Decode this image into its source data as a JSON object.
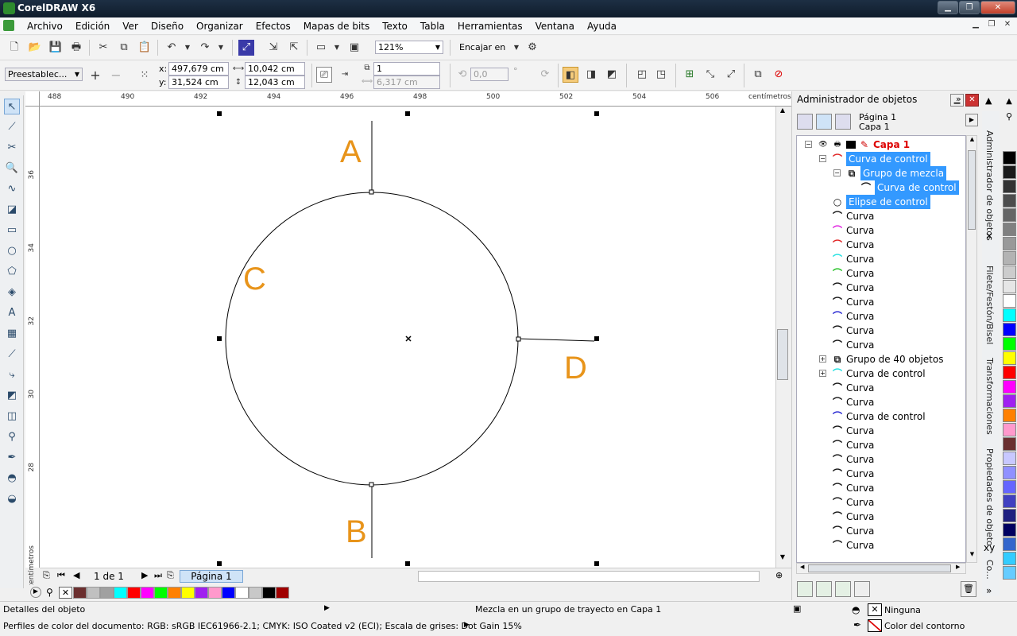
{
  "window": {
    "title": "CorelDRAW X6"
  },
  "menu": {
    "items": [
      "Archivo",
      "Edición",
      "Ver",
      "Diseño",
      "Organizar",
      "Efectos",
      "Mapas de bits",
      "Texto",
      "Tabla",
      "Herramientas",
      "Ventana",
      "Ayuda"
    ]
  },
  "toolbar1": {
    "zoom": "121%",
    "snap_label": "Encajar en"
  },
  "toolbar2": {
    "preset": "Preestablec...",
    "x": "497,679 cm",
    "y": "31,524 cm",
    "width": "10,042 cm",
    "height": "12,043 cm",
    "steps": "1",
    "spacing": "6,317 cm",
    "rotation": "0,0",
    "x_label": "x:",
    "y_label": "y:"
  },
  "ruler": {
    "h_ticks": [
      "488",
      "490",
      "492",
      "494",
      "496",
      "498",
      "500",
      "502",
      "504",
      "506"
    ],
    "h_unit": "centímetros",
    "v_ticks": [
      "36",
      "34",
      "32",
      "30",
      "28"
    ],
    "v_unit": "centímetros"
  },
  "canvas": {
    "labels": [
      "A",
      "B",
      "C",
      "D"
    ]
  },
  "pagebar": {
    "counter": "1 de 1",
    "tab": "Página 1"
  },
  "docker": {
    "title": "Administrador de objetos",
    "page": "Página 1",
    "layer": "Capa 1",
    "tree": [
      {
        "label": "Capa 1",
        "kind": "layer",
        "indent": 0,
        "expander": "−",
        "icon": "pen-icon",
        "color": "#d00000"
      },
      {
        "label": "Curva de control",
        "kind": "selected",
        "indent": 1,
        "expander": "−",
        "icon": "curve-icon",
        "color": "#e02020"
      },
      {
        "label": "Grupo de mezcla",
        "kind": "selected",
        "indent": 2,
        "expander": "−",
        "icon": "group-icon",
        "color": "#222222"
      },
      {
        "label": "Curva de control",
        "kind": "selected",
        "indent": 3,
        "expander": "",
        "icon": "curve-icon",
        "color": "#111111"
      },
      {
        "label": "Elipse de control",
        "kind": "selected",
        "indent": 1,
        "expander": "",
        "icon": "ellipse-icon",
        "color": "#111111"
      },
      {
        "label": "Curva",
        "kind": "normal",
        "indent": 1,
        "expander": "",
        "icon": "curve-icon",
        "color": "#111111"
      },
      {
        "label": "Curva",
        "kind": "normal",
        "indent": 1,
        "expander": "",
        "icon": "curve-icon",
        "color": "#e020e0"
      },
      {
        "label": "Curva",
        "kind": "normal",
        "indent": 1,
        "expander": "",
        "icon": "curve-icon",
        "color": "#e02020"
      },
      {
        "label": "Curva",
        "kind": "normal",
        "indent": 1,
        "expander": "",
        "icon": "curve-icon",
        "color": "#20e0e0"
      },
      {
        "label": "Curva",
        "kind": "normal",
        "indent": 1,
        "expander": "",
        "icon": "curve-icon",
        "color": "#20c020"
      },
      {
        "label": "Curva",
        "kind": "normal",
        "indent": 1,
        "expander": "",
        "icon": "curve-icon",
        "color": "#111111"
      },
      {
        "label": "Curva",
        "kind": "normal",
        "indent": 1,
        "expander": "",
        "icon": "curve-icon",
        "color": "#111111"
      },
      {
        "label": "Curva",
        "kind": "normal",
        "indent": 1,
        "expander": "",
        "icon": "curve-icon",
        "color": "#2020d0"
      },
      {
        "label": "Curva",
        "kind": "normal",
        "indent": 1,
        "expander": "",
        "icon": "curve-icon",
        "color": "#111111"
      },
      {
        "label": "Curva",
        "kind": "normal",
        "indent": 1,
        "expander": "",
        "icon": "curve-icon",
        "color": "#111111"
      },
      {
        "label": "Grupo de 40 objetos",
        "kind": "normal",
        "indent": 1,
        "expander": "+",
        "icon": "group-icon",
        "color": "#222222"
      },
      {
        "label": "Curva de control",
        "kind": "normal",
        "indent": 1,
        "expander": "+",
        "icon": "curve-icon",
        "color": "#20e0e0"
      },
      {
        "label": "Curva",
        "kind": "normal",
        "indent": 1,
        "expander": "",
        "icon": "curve-icon",
        "color": "#111111"
      },
      {
        "label": "Curva",
        "kind": "normal",
        "indent": 1,
        "expander": "",
        "icon": "curve-icon",
        "color": "#111111"
      },
      {
        "label": "Curva de control",
        "kind": "normal",
        "indent": 1,
        "expander": "",
        "icon": "curve-icon",
        "color": "#2020d0"
      },
      {
        "label": "Curva",
        "kind": "normal",
        "indent": 1,
        "expander": "",
        "icon": "curve-icon",
        "color": "#111111"
      },
      {
        "label": "Curva",
        "kind": "normal",
        "indent": 1,
        "expander": "",
        "icon": "curve-icon",
        "color": "#111111"
      },
      {
        "label": "Curva",
        "kind": "normal",
        "indent": 1,
        "expander": "",
        "icon": "curve-icon",
        "color": "#111111"
      },
      {
        "label": "Curva",
        "kind": "normal",
        "indent": 1,
        "expander": "",
        "icon": "curve-icon",
        "color": "#111111"
      },
      {
        "label": "Curva",
        "kind": "normal",
        "indent": 1,
        "expander": "",
        "icon": "curve-icon",
        "color": "#111111"
      },
      {
        "label": "Curva",
        "kind": "normal",
        "indent": 1,
        "expander": "",
        "icon": "curve-icon",
        "color": "#111111"
      },
      {
        "label": "Curva",
        "kind": "normal",
        "indent": 1,
        "expander": "",
        "icon": "curve-icon",
        "color": "#111111"
      },
      {
        "label": "Curva",
        "kind": "normal",
        "indent": 1,
        "expander": "",
        "icon": "curve-icon",
        "color": "#111111"
      },
      {
        "label": "Curva",
        "kind": "normal",
        "indent": 1,
        "expander": "",
        "icon": "curve-icon",
        "color": "#111111"
      }
    ]
  },
  "side_tabs": [
    "Administrador de objetos",
    "Filete/Festón/Bisel",
    "Transformaciones",
    "Propiedades de objeto",
    "Co..."
  ],
  "side_tab_xy": "xy",
  "palette_bottom": [
    "#6b2f2f",
    "#c0c0c0",
    "#a0a0a0",
    "#00ffff",
    "#ff0000",
    "#ff00ff",
    "#00ff00",
    "#ff8000",
    "#ffff00",
    "#a020f0",
    "#ff99cc",
    "#0000ff",
    "#ffffff",
    "#c8c8c8",
    "#000000",
    "#a00000"
  ],
  "palette_right": [
    "#000000",
    "#1a1a1a",
    "#333333",
    "#4d4d4d",
    "#666666",
    "#808080",
    "#999999",
    "#b3b3b3",
    "#cccccc",
    "#e6e6e6",
    "#ffffff",
    "#00ffff",
    "#0000ff",
    "#00ff00",
    "#ffff00",
    "#ff0000",
    "#ff00ff",
    "#a020f0",
    "#ff8000",
    "#ff99cc",
    "#6b2f2f",
    "#c8c8ff",
    "#9090ff",
    "#6666ff",
    "#4040c0",
    "#202080",
    "#000060",
    "#3366cc",
    "#33ccff",
    "#66ccff"
  ],
  "status": {
    "object_details": "Detalles del objeto",
    "message": "Mezcla en un grupo de trayecto en Capa 1",
    "color_profiles": "Perfiles de color del documento: RGB: sRGB IEC61966-2.1; CMYK: ISO Coated v2 (ECI); Escala de grises: Dot Gain 15%",
    "fill": "Ninguna",
    "outline": "Color del contorno"
  }
}
